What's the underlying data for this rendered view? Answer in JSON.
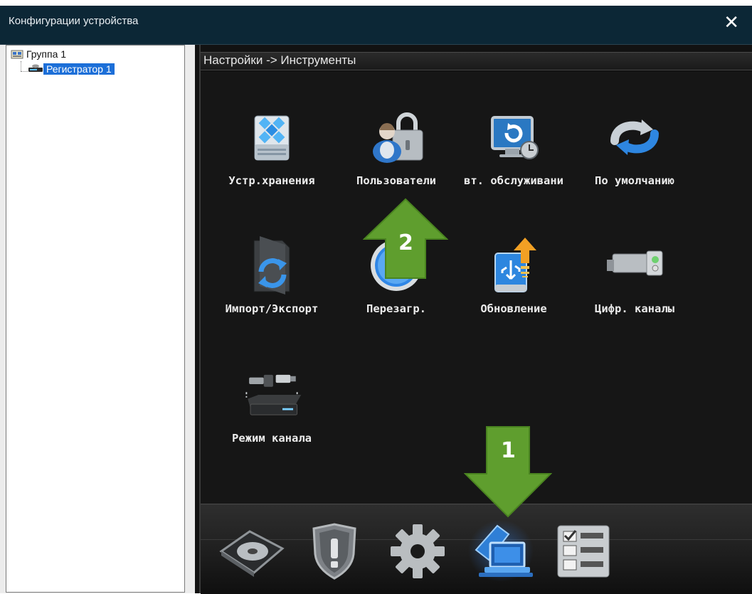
{
  "window": {
    "title": "Конфигурации устройства",
    "close_glyph": "✕"
  },
  "tree": {
    "group_label": "Группа 1",
    "device_label": "Регистратор 1"
  },
  "breadcrumb": "Настройки -> Инструменты",
  "tools": [
    {
      "id": "storage",
      "label": "Устр.хранения",
      "icon": "storage-drive-icon"
    },
    {
      "id": "users",
      "label": "Пользователи",
      "icon": "users-lock-icon"
    },
    {
      "id": "maintenance",
      "label": "вт. обслуживани",
      "icon": "auto-maintenance-icon"
    },
    {
      "id": "default",
      "label": "По умолчанию",
      "icon": "restore-default-icon"
    },
    {
      "id": "import_export",
      "label": "Импорт/Экспорт",
      "icon": "import-export-icon"
    },
    {
      "id": "reboot",
      "label": "Перезагр.",
      "icon": "reboot-icon"
    },
    {
      "id": "update",
      "label": "Обновление",
      "icon": "usb-update-icon"
    },
    {
      "id": "digital_channels",
      "label": "Цифр. каналы",
      "icon": "ip-camera-icon"
    },
    {
      "id": "channel_mode",
      "label": "Режим канала",
      "icon": "channel-mode-icon"
    }
  ],
  "toolbar": [
    {
      "id": "record",
      "icon": "hdd-record-icon",
      "active": false
    },
    {
      "id": "alarm",
      "icon": "alarm-shield-icon",
      "active": false
    },
    {
      "id": "system",
      "icon": "system-gear-icon",
      "active": false
    },
    {
      "id": "tools",
      "icon": "tools-monitor-icon",
      "active": true
    },
    {
      "id": "info",
      "icon": "info-checklist-icon",
      "active": false
    }
  ],
  "annotations": {
    "step1": "1",
    "step2": "2",
    "arrow_color": "#5f9e2e"
  }
}
